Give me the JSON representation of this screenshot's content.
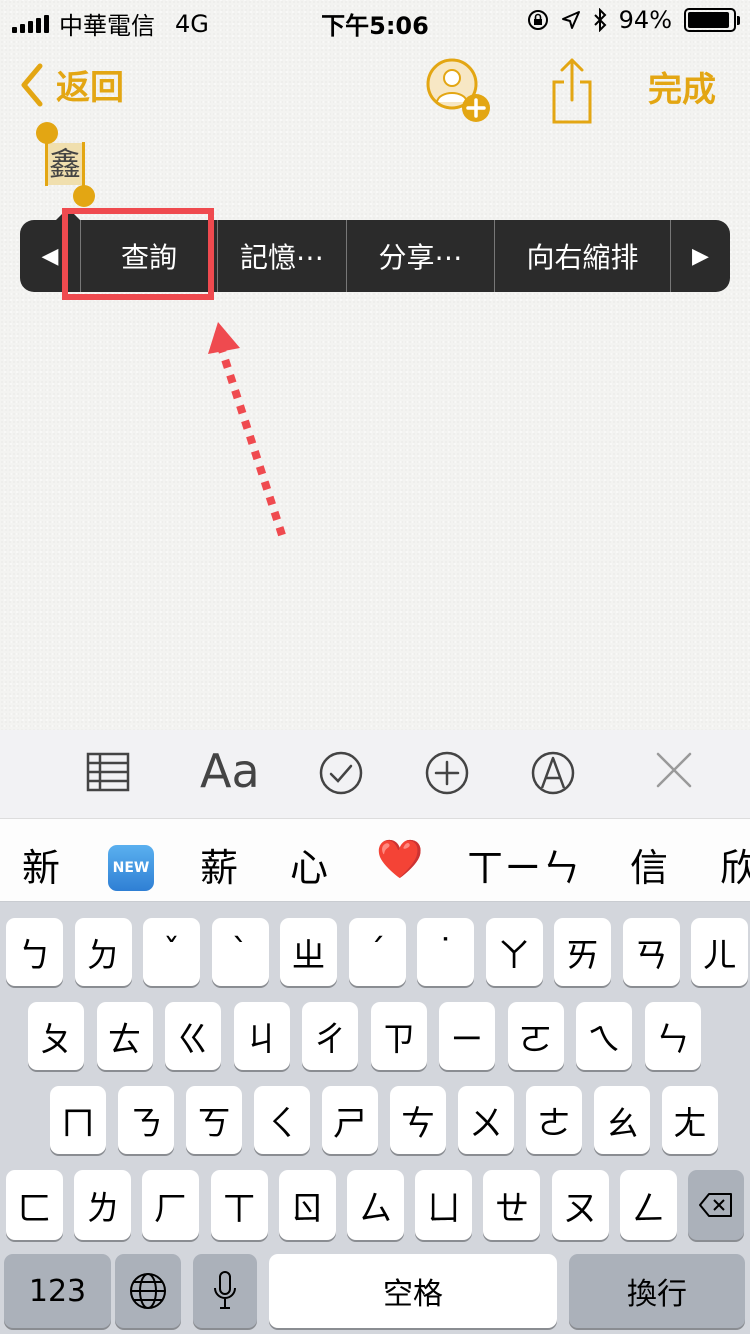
{
  "status_bar": {
    "carrier": "中華電信",
    "network": "4G",
    "time": "下午5:06",
    "battery_percent": "94%",
    "battery_level": 0.94
  },
  "nav": {
    "back_label": "返回",
    "done_label": "完成",
    "icons": [
      "add-person-icon",
      "share-icon"
    ]
  },
  "note": {
    "selected_text": "鑫"
  },
  "context_menu": {
    "items": [
      "查詢",
      "記憶⋯",
      "分享⋯",
      "向右縮排"
    ],
    "prev_arrow": "◀",
    "next_arrow": "▶"
  },
  "format_toolbar": {
    "icons": [
      "table-icon",
      "text-style-icon",
      "checklist-icon",
      "add-icon",
      "markup-icon",
      "close-icon"
    ],
    "text_style_label": "Aa"
  },
  "suggestions": {
    "items": [
      "新",
      "NEW",
      "薪",
      "心",
      "❤️",
      "ㄒㄧㄣ",
      "信",
      "欣"
    ]
  },
  "keyboard": {
    "row1": [
      "ㄅ",
      "ㄉ",
      "ˇ",
      "ˋ",
      "ㄓ",
      "ˊ",
      "˙",
      "ㄚ",
      "ㄞ",
      "ㄢ",
      "ㄦ"
    ],
    "row2": [
      "ㄆ",
      "ㄊ",
      "ㄍ",
      "ㄐ",
      "ㄔ",
      "ㄗ",
      "ㄧ",
      "ㄛ",
      "ㄟ",
      "ㄣ"
    ],
    "row3": [
      "ㄇ",
      "ㄋ",
      "ㄎ",
      "ㄑ",
      "ㄕ",
      "ㄘ",
      "ㄨ",
      "ㄜ",
      "ㄠ",
      "ㄤ"
    ],
    "row4": [
      "ㄈ",
      "ㄌ",
      "ㄏ",
      "ㄒ",
      "ㄖ",
      "ㄙ",
      "ㄩ",
      "ㄝ",
      "ㄡ",
      "ㄥ"
    ],
    "numbers_label": "123",
    "space_label": "空格",
    "return_label": "換行"
  }
}
